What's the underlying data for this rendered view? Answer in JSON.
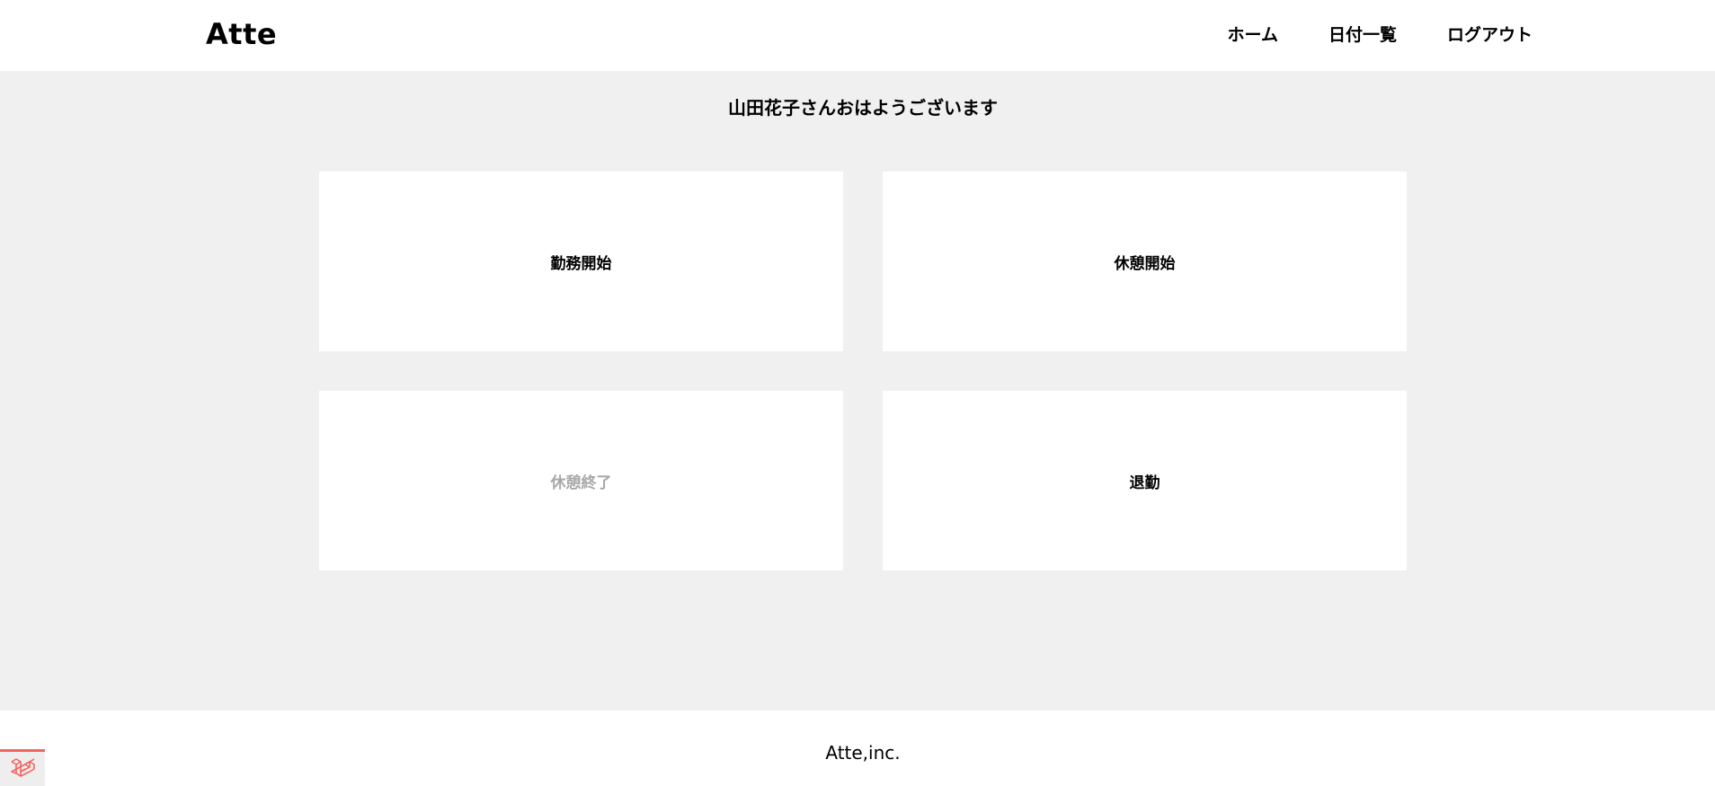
{
  "header": {
    "logo": "Atte",
    "nav": {
      "home": "ホーム",
      "attendance_list": "日付一覧",
      "logout": "ログアウト"
    }
  },
  "main": {
    "greeting": "山田花子さんおはようございます",
    "buttons": {
      "work_start": "勤務開始",
      "break_start": "休憩開始",
      "break_end": "休憩終了",
      "work_end": "退勤"
    }
  },
  "footer": {
    "copyright": "Atte,inc."
  },
  "colors": {
    "background": "#f0f0f0",
    "panel": "#ffffff",
    "disabled_text": "#a8a8a8",
    "debugbar_accent": "#f4645f"
  },
  "icons": {
    "debugbar": "laravel-logo-icon"
  }
}
